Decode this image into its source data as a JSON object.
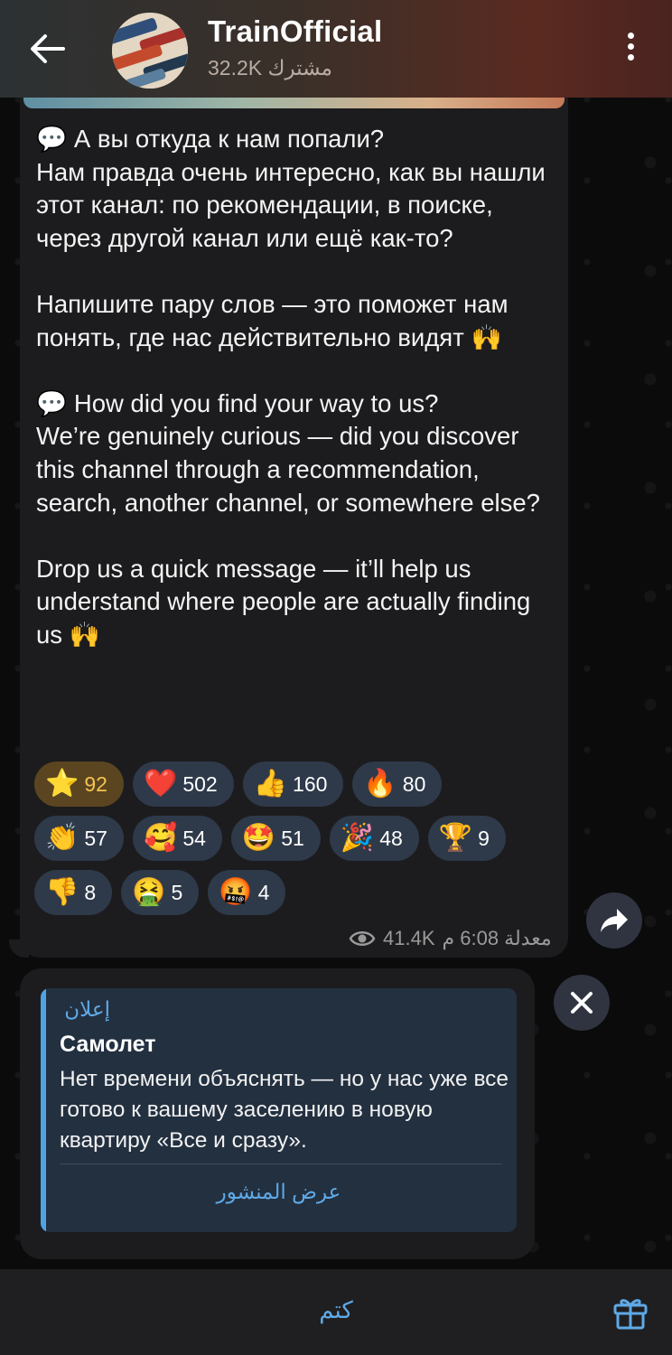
{
  "header": {
    "title": "TrainOfficial",
    "subtitle": "32.2K مشترك",
    "back_icon": "arrow-left-icon",
    "menu_icon": "more-vertical-icon"
  },
  "message": {
    "text": "💬 А вы откуда к нам попали?\nНам правда очень интересно, как вы нашли этот канал: по рекомендации, в поиске, через другой канал или ещё как-то?\n\nНапишите пару слов — это поможет нам понять, где нас действительно видят 🙌\n\n💬 How did you find your way to us?\nWe’re genuinely curious — did you discover this channel through a recommendation, search, another channel, or somewhere else?\n\nDrop us a quick message — it’ll help us understand where people are actually finding us 🙌",
    "reactions": [
      [
        {
          "emoji": "⭐",
          "count": "92",
          "kind": "star"
        },
        {
          "emoji": "❤️",
          "count": "502"
        },
        {
          "emoji": "👍",
          "count": "160"
        },
        {
          "emoji": "🔥",
          "count": "80"
        }
      ],
      [
        {
          "emoji": "👏",
          "count": "57"
        },
        {
          "emoji": "🥰",
          "count": "54"
        },
        {
          "emoji": "🤩",
          "count": "51"
        },
        {
          "emoji": "🎉",
          "count": "48"
        },
        {
          "emoji": "🏆",
          "count": "9"
        }
      ],
      [
        {
          "emoji": "👎",
          "count": "8"
        },
        {
          "emoji": "🤮",
          "count": "5"
        },
        {
          "emoji": "🤬",
          "count": "4"
        }
      ]
    ],
    "views": "41.4K",
    "time": "معدلة 6:08 م"
  },
  "ad": {
    "label": "إعلان",
    "title": "Самолет",
    "body": "Нет времени объяснять — но у нас уже все готово к вашему заселению в новую квартиру «Все и сразу».",
    "cta": "عرض المنشور"
  },
  "bottom": {
    "mute_label": "كتم",
    "gift_icon": "gift-icon"
  },
  "colors": {
    "accent": "#5fa9e6",
    "bubble": "#1c1c1e",
    "reaction_chip": "#2e3a4a",
    "star_chip": "#5b4520"
  }
}
